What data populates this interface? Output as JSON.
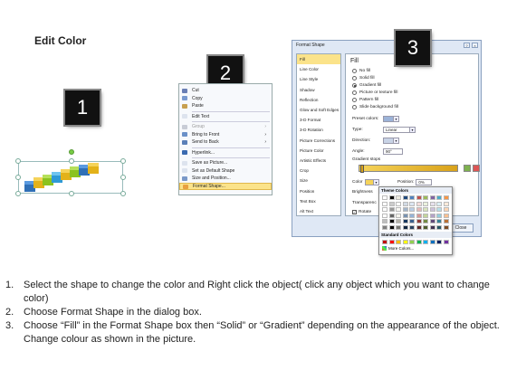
{
  "title": "Edit Color",
  "step_numbers": [
    "1",
    "2",
    "3"
  ],
  "context_menu": {
    "items": [
      {
        "label": "Cut",
        "icon": "scissors-icon",
        "color": "#6a7fb5",
        "disabled": false
      },
      {
        "label": "Copy",
        "icon": "copy-icon",
        "color": "#7a9ad0",
        "disabled": false
      },
      {
        "label": "Paste",
        "icon": "paste-icon",
        "color": "#c8a050",
        "disabled": false
      },
      {
        "label": "Edit Text",
        "icon": "edit-text-icon",
        "color": "#dde3ee",
        "disabled": false
      },
      {
        "label": "Group",
        "icon": "group-icon",
        "color": "#c8ccd6",
        "disabled": true,
        "submenu": true
      },
      {
        "label": "Bring to Front",
        "icon": "bring-to-front-icon",
        "color": "#6a90c8",
        "disabled": false,
        "submenu": true
      },
      {
        "label": "Send to Back",
        "icon": "send-to-back-icon",
        "color": "#5a7fb8",
        "disabled": false,
        "submenu": true
      },
      {
        "label": "Hyperlink...",
        "icon": "hyperlink-icon",
        "color": "#3a6ab0",
        "disabled": false
      },
      {
        "label": "Save as Picture...",
        "icon": "picture-icon",
        "color": "#dde3ee",
        "disabled": false
      },
      {
        "label": "Set as Default Shape",
        "icon": "default-shape-icon",
        "color": "#dde3ee",
        "disabled": false
      },
      {
        "label": "Size and Position...",
        "icon": "size-position-icon",
        "color": "#7a98c8",
        "disabled": false
      },
      {
        "label": "Format Shape...",
        "icon": "format-shape-icon",
        "color": "#e8a040",
        "disabled": false,
        "highlight": true
      }
    ]
  },
  "dialog": {
    "title": "Format Shape",
    "categories": [
      "Fill",
      "Line Color",
      "Line Style",
      "Shadow",
      "Reflection",
      "Glow and Soft Edges",
      "3-D Format",
      "3-D Rotation",
      "Picture Corrections",
      "Picture Color",
      "Artistic Effects",
      "Crop",
      "Size",
      "Position",
      "Text Box",
      "Alt Text"
    ],
    "selected_category": "Fill",
    "fill_heading": "Fill",
    "fill_options": [
      {
        "label": "No fill",
        "on": false
      },
      {
        "label": "Solid fill",
        "on": false
      },
      {
        "label": "Gradient fill",
        "on": true
      },
      {
        "label": "Picture or texture fill",
        "on": false
      },
      {
        "label": "Pattern fill",
        "on": false
      },
      {
        "label": "Slide background fill",
        "on": false
      }
    ],
    "preset_colors_label": "Preset colors:",
    "type_label": "Type:",
    "type_value": "Linear",
    "direction_label": "Direction:",
    "angle_label": "Angle:",
    "angle_value": "90°",
    "gradient_stops_label": "Gradient stops",
    "color_label": "Color",
    "position_label": "Position:",
    "position_value": "0%",
    "brightness_label": "Brightness",
    "transparency_label": "Transparenc",
    "rotate_label": "Rotate",
    "close_label": "Close"
  },
  "palette": {
    "theme_label": "Theme Colors",
    "standard_label": "Standard Colors",
    "more_label": "More Colors...",
    "theme_top": [
      "#ffffff",
      "#000000",
      "#eeece1",
      "#1f497d",
      "#4f81bd",
      "#c0504d",
      "#9bbb59",
      "#8064a2",
      "#4bacc6",
      "#f79646"
    ],
    "standard": [
      "#c00000",
      "#ff0000",
      "#ffc000",
      "#ffff00",
      "#92d050",
      "#00b050",
      "#00b0f0",
      "#0070c0",
      "#002060",
      "#7030a0"
    ]
  },
  "instructions": [
    {
      "n": "1.",
      "text": "Select the shape to change the color and Right click the object( click any object which you want to change color)"
    },
    {
      "n": "2.",
      "text": "Choose Format Shape in the dialog box."
    },
    {
      "n": "3.",
      "text": "Choose “Fill” in the Format Shape box then “Solid” or “Gradient” depending on the appearance of the object. Change colour as shown in the picture."
    }
  ]
}
